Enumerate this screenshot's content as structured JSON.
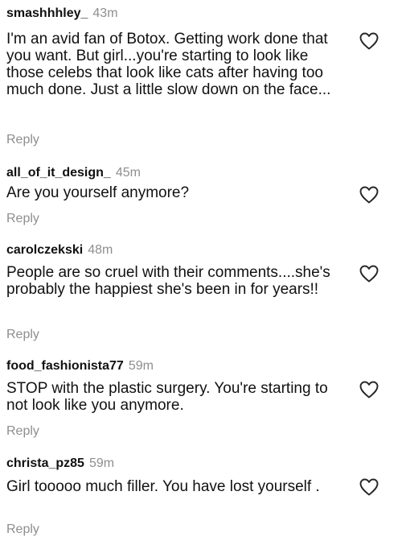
{
  "comments": [
    {
      "username": "smashhhley_",
      "time": "43m",
      "text": "I'm an avid fan of Botox. Getting work done that you want. But girl...you're starting to look like those celebs that look like cats after having too much done. Just a little slow down on the face...",
      "reply_label": "Reply",
      "icon": "heart-outline-icon"
    },
    {
      "username": "all_of_it_design_",
      "time": "45m",
      "text": "Are you yourself anymore?",
      "reply_label": "Reply",
      "icon": "heart-outline-icon"
    },
    {
      "username": "carolczekski",
      "time": "48m",
      "text": "People are so cruel with their comments....she's probably the happiest she's been in for years!!",
      "reply_label": "Reply",
      "icon": "heart-outline-icon"
    },
    {
      "username": "food_fashionista77",
      "time": "59m",
      "text": "STOP with the plastic surgery. You're starting to not look like you anymore.",
      "reply_label": "Reply",
      "icon": "heart-outline-icon"
    },
    {
      "username": "christa_pz85",
      "time": "59m",
      "text": "Girl tooooo much filler. You have lost yourself .",
      "reply_label": "Reply",
      "icon": "heart-outline-icon"
    }
  ],
  "colors": {
    "text": "#111111",
    "muted": "#8e8e8e",
    "background": "#ffffff"
  }
}
